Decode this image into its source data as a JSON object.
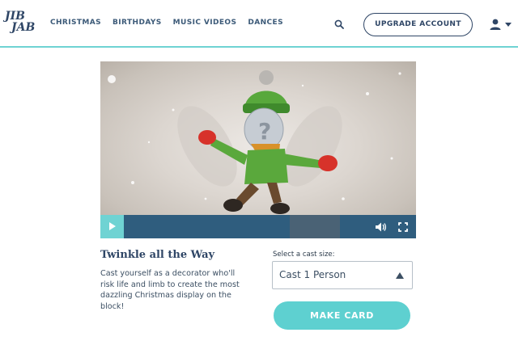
{
  "header": {
    "logo_text": "JIB JAB",
    "logo_line1": "JIB",
    "logo_line2": "JAB",
    "nav": [
      {
        "label": "CHRISTMAS"
      },
      {
        "label": "BIRTHDAYS"
      },
      {
        "label": "MUSIC VIDEOS"
      },
      {
        "label": "DANCES"
      }
    ],
    "search_icon": "search-icon",
    "upgrade_label": "UPGRADE ACCOUNT",
    "account_icon": "user-icon"
  },
  "video": {
    "play_icon": "play-icon",
    "volume_icon": "volume-icon",
    "fullscreen_icon": "fullscreen-icon",
    "buffered_fraction": 0.87
  },
  "card": {
    "title": "Twinkle all the Way",
    "description": "Cast yourself as a decorator who'll risk life and limb to create the most dazzling Christmas display on the block!"
  },
  "cast": {
    "label": "Select a cast size:",
    "selected": "Cast 1 Person"
  },
  "make_card_label": "MAKE CARD",
  "colors": {
    "accent": "#5ed0d0",
    "navy": "#2f4666",
    "controls": "#2f5d7e"
  }
}
